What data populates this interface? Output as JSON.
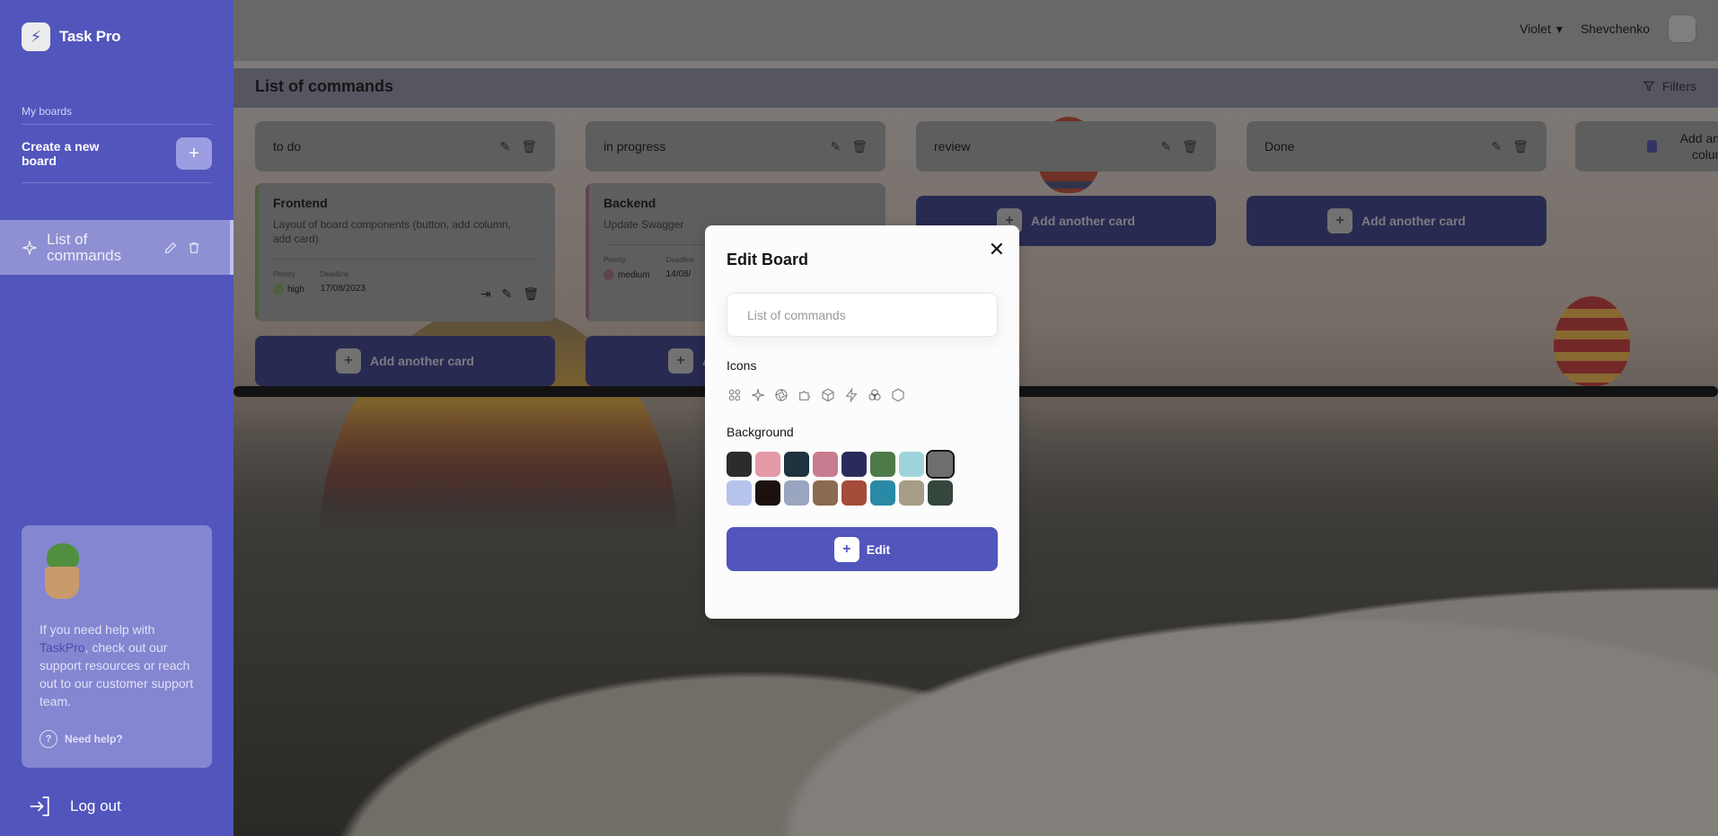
{
  "app": {
    "name": "Task Pro"
  },
  "sidebar": {
    "my_boards_label": "My boards",
    "create_board_label": "Create a new board",
    "create_board_button": "+",
    "boards": [
      {
        "title": "List of commands",
        "icon": "sparkle-icon"
      }
    ],
    "help": {
      "text_before": "If you need help with ",
      "brand": "TaskPro",
      "text_after": ", check out our support resources or reach out to our customer support team.",
      "need_help_label": "Need help?"
    },
    "logout_label": "Log out"
  },
  "header": {
    "theme_label": "Violet",
    "user_name": "Shevchenko"
  },
  "board": {
    "title": "List of commands",
    "filters_label": "Filters",
    "columns": [
      {
        "title": "to do",
        "cards": [
          {
            "title": "Frontend",
            "description": "Layout of board components (button, add column, add card)",
            "priority_label": "Priority",
            "priority": "high",
            "deadline_label": "Deadline",
            "deadline": "17/08/2023"
          }
        ],
        "add_card_label": "Add another card"
      },
      {
        "title": "in progress",
        "cards": [
          {
            "title": "Backend",
            "description": "Update Swagger",
            "priority_label": "Priority",
            "priority": "medium",
            "deadline_label": "Deadline",
            "deadline": "14/08/"
          }
        ],
        "add_card_label": "Ad"
      },
      {
        "title": "review",
        "cards": [],
        "add_card_label": "Add another card"
      },
      {
        "title": "Done",
        "cards": [],
        "add_card_label": "Add another card"
      }
    ],
    "add_column_label": "Add anothe column"
  },
  "modal": {
    "title": "Edit Board",
    "input_placeholder": "List of commands",
    "icons_label": "Icons",
    "icons": [
      "four-circles-icon",
      "sparkle-icon",
      "aperture-icon",
      "puzzle-icon",
      "cube-icon",
      "lightning-icon",
      "colors-icon",
      "hexagon-icon"
    ],
    "background_label": "Background",
    "backgrounds": [
      {
        "name": "none",
        "color": "#2c2c2c"
      },
      {
        "name": "blossom",
        "color": "#e39aa8"
      },
      {
        "name": "night-trees",
        "color": "#1f3240"
      },
      {
        "name": "pink-tree",
        "color": "#c77d8f"
      },
      {
        "name": "moon-sky",
        "color": "#2b2b5b"
      },
      {
        "name": "palm-leaves",
        "color": "#4e7a4a"
      },
      {
        "name": "clouds",
        "color": "#9fd3dc"
      },
      {
        "name": "storm",
        "color": "#6e6e6e"
      },
      {
        "name": "bubble",
        "color": "#b6c4ec"
      },
      {
        "name": "eclipse",
        "color": "#1b120d"
      },
      {
        "name": "balloon-sky",
        "color": "#9aa6bf"
      },
      {
        "name": "rocks",
        "color": "#8a6a50"
      },
      {
        "name": "sunset",
        "color": "#a54c3b"
      },
      {
        "name": "sea",
        "color": "#2a8aa5"
      },
      {
        "name": "balloons",
        "color": "#a79c86"
      },
      {
        "name": "night-sky",
        "color": "#35463d"
      }
    ],
    "selected_background": 7,
    "submit_label": "Edit"
  }
}
